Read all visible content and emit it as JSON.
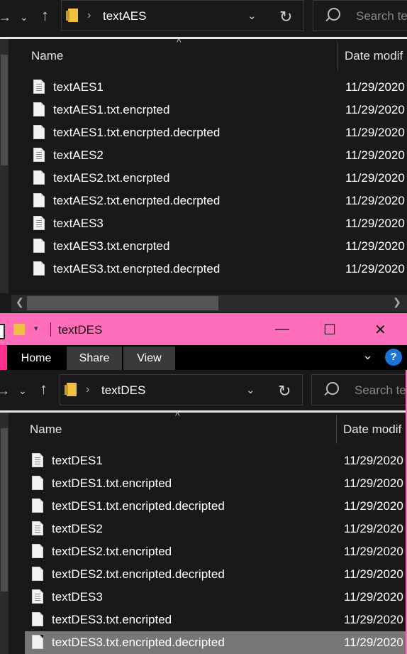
{
  "aes_window": {
    "breadcrumb": "textAES",
    "search_placeholder": "Search te",
    "columns": {
      "name": "Name",
      "date": "Date modif"
    },
    "files": [
      {
        "name": "textAES1",
        "icon": "text-document-icon",
        "date": "11/29/2020"
      },
      {
        "name": "textAES1.txt.encrpted",
        "icon": "blank-file-icon",
        "date": "11/29/2020"
      },
      {
        "name": "textAES1.txt.encrpted.decrpted",
        "icon": "blank-file-icon",
        "date": "11/29/2020"
      },
      {
        "name": "textAES2",
        "icon": "text-document-icon",
        "date": "11/29/2020"
      },
      {
        "name": "textAES2.txt.encrpted",
        "icon": "blank-file-icon",
        "date": "11/29/2020"
      },
      {
        "name": "textAES2.txt.encrpted.decrpted",
        "icon": "blank-file-icon",
        "date": "11/29/2020"
      },
      {
        "name": "textAES3",
        "icon": "text-document-icon",
        "date": "11/29/2020"
      },
      {
        "name": "textAES3.txt.encrpted",
        "icon": "blank-file-icon",
        "date": "11/29/2020"
      },
      {
        "name": "textAES3.txt.encrpted.decrpted",
        "icon": "blank-file-icon",
        "date": "11/29/2020"
      }
    ]
  },
  "des_window": {
    "title": "textDES",
    "ribbon_tabs": [
      "Home",
      "Share",
      "View"
    ],
    "help_label": "?",
    "breadcrumb": "textDES",
    "search_placeholder": "Search te",
    "columns": {
      "name": "Name",
      "date": "Date modif"
    },
    "selected_file": "textDES3.txt.encripted.decripted",
    "files": [
      {
        "name": "textDES1",
        "icon": "text-document-icon",
        "date": "11/29/2020"
      },
      {
        "name": "textDES1.txt.encripted",
        "icon": "blank-file-icon",
        "date": "11/29/2020"
      },
      {
        "name": "textDES1.txt.encripted.decripted",
        "icon": "blank-file-icon",
        "date": "11/29/2020"
      },
      {
        "name": "textDES2",
        "icon": "text-document-icon",
        "date": "11/29/2020"
      },
      {
        "name": "textDES2.txt.encripted",
        "icon": "blank-file-icon",
        "date": "11/29/2020"
      },
      {
        "name": "textDES2.txt.encripted.decripted",
        "icon": "blank-file-icon",
        "date": "11/29/2020"
      },
      {
        "name": "textDES3",
        "icon": "text-document-icon",
        "date": "11/29/2020"
      },
      {
        "name": "textDES3.txt.encripted",
        "icon": "blank-file-icon",
        "date": "11/29/2020"
      },
      {
        "name": "textDES3.txt.encripted.decripted",
        "icon": "blank-file-icon",
        "date": "11/29/2020"
      }
    ]
  },
  "colors": {
    "title_bar": "#ff6eba",
    "accent": "#ff2f8a",
    "selection": "#777777",
    "background": "#191919"
  }
}
